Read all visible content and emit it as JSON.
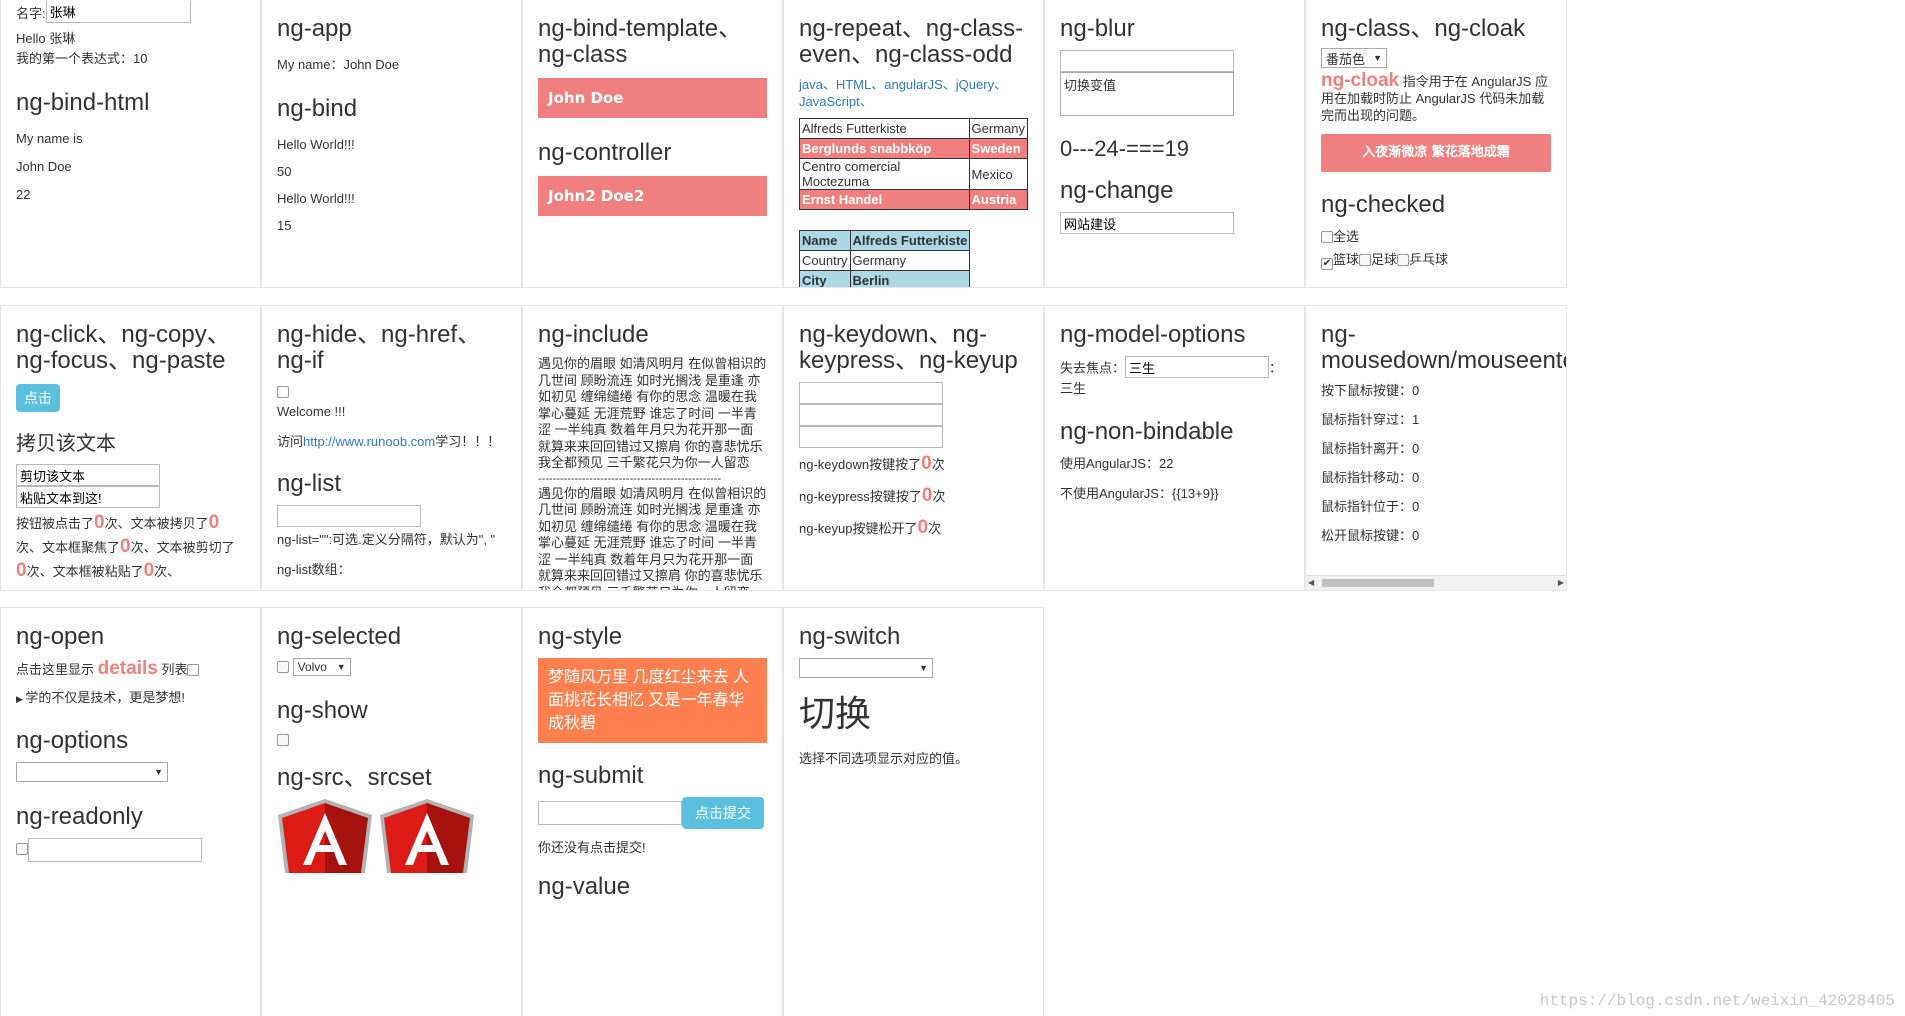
{
  "c1": {
    "name_label": "名字:",
    "name_value": "张琳",
    "hello": "Hello 张琳",
    "expr": "我的第一个表达式：10",
    "title": "ng-bind-html",
    "line1": "My name is",
    "line2": "John Doe",
    "line3": "22"
  },
  "c2": {
    "title": "ng-app",
    "line1": "My name：John Doe",
    "title2": "ng-bind",
    "l1": "Hello World!!!",
    "l2": "50",
    "l3": "Hello World!!!",
    "l4": "15"
  },
  "c3": {
    "title": "ng-bind-template、ng-class",
    "bar": "John Doe",
    "title2": "ng-controller",
    "bar2": "John2 Doe2"
  },
  "c4": {
    "title": "ng-repeat、ng-class-even、ng-class-odd",
    "links": "java、HTML、angularJS、jQuery、JavaScript、",
    "table": [
      [
        "Alfreds Futterkiste",
        "Germany"
      ],
      [
        "Berglunds snabbköp",
        "Sweden"
      ],
      [
        "Centro comercial Moctezuma",
        "Mexico"
      ],
      [
        "Ernst Handel",
        "Austria"
      ]
    ],
    "table2": [
      [
        "Name",
        "Alfreds Futterkiste"
      ],
      [
        "Country",
        "Germany"
      ],
      [
        "City",
        "Berlin"
      ]
    ]
  },
  "c5": {
    "title": "ng-blur",
    "textarea": "切换变值",
    "result": "0---24-===19",
    "title2": "ng-change",
    "input": "网站建设"
  },
  "c6": {
    "title": "ng-class、ng-cloak",
    "select": "番茄色",
    "cloak_word": "ng-cloak",
    "cloak_text": " 指令用于在 AngularJS 应用在加载时防止 AngularJS 代码未加载完而出现的问题。",
    "bar": "入夜渐微凉 繁花落地成霜",
    "title2": "ng-checked",
    "all": "全选",
    "opt1": "篮球",
    "opt2": "足球",
    "opt3": "乒乓球"
  },
  "r2c1": {
    "title": "ng-click、ng-copy、ng-focus、ng-paste",
    "button": "点击",
    "copy_title": "拷贝该文本",
    "in1": "剪切该文本",
    "in2": "粘贴文本到这!",
    "t1": "按钮被点击了",
    "n1": "0",
    "t2": "次、文本被拷贝了",
    "n2": "0",
    "t3": "次、文本框聚焦了",
    "n3": "0",
    "t4": "次、文本被剪切了",
    "n4": "0",
    "t5": "次、文本框被粘贴了",
    "n5": "0",
    "t6": "次、"
  },
  "r2c2": {
    "title": "ng-hide、ng-href、ng-if",
    "welcome": "Welcome !!!",
    "visit": "访问",
    "url": "http://www.runoob.com",
    "learn": "学习！！！",
    "title2": "ng-list",
    "hint": "ng-list=\"\":可选.定义分隔符，默认为\", \"",
    "arr": "ng-list数组："
  },
  "r2c3": {
    "title": "ng-include",
    "poem": "遇见你的眉眼 如清风明月 在似曾相识的几世间 顾盼流连 如时光搁浅 是重逢 亦如初见 缠绵缱绻 有你的思念 温暖在我掌心蔓延 无涯荒野 谁忘了时间 一半青涩 一半纯真 数着年月只为花开那一面 就算来来回回错过又擦肩 你的喜悲忧乐我全都预见 三千繁花只为你一人留恋",
    "dash": "--------------------------------------------------",
    "poem2": "遇见你的眉眼 如清风明月 在似曾相识的几世间 顾盼流连 如时光搁浅 是重逢 亦如初见 缠绵缱绻 有你的思念 温暖在我掌心蔓延 无涯荒野 谁忘了时间 一半青涩 一半纯真 数着年月只为花开那一面 就算来来回回错过又擦肩 你的喜悲忧乐我全都预见 三千繁花只为你一人留恋",
    "dash2": "--------------------------------------------------"
  },
  "r2c4": {
    "title": "ng-keydown、ng-keypress、ng-keyup",
    "k1": "ng-keydown按键按了",
    "k2": "ng-keypress按键按了",
    "k3": "ng-keyup按键松开了",
    "n": "0",
    "unit": "次"
  },
  "r2c5": {
    "title": "ng-model-options",
    "label": "失去焦点：",
    "value": "三生",
    "after": "：三生",
    "title2": "ng-non-bindable",
    "l1": "使用AngularJS：22",
    "l2": "不使用AngularJS：{{13+9}}"
  },
  "r2c6": {
    "title": "ng-mousedown/mouseenter/mouseleave",
    "l1": "按下鼠标按键：0",
    "l2": "鼠标指针穿过：1",
    "l3": "鼠标指针离开：0",
    "l4": "鼠标指针移动：0",
    "l5": "鼠标指针位于：0",
    "l6": "松开鼠标按键：0"
  },
  "r3c1": {
    "title": "ng-open",
    "line_a": "点击这里显示 ",
    "details": "details",
    "line_b": " 列表",
    "summary": "学的不仅是技术，更是梦想!",
    "title2": "ng-options",
    "title3": "ng-readonly"
  },
  "r3c2": {
    "title": "ng-selected",
    "select": "Volvo",
    "title2": "ng-show",
    "title3": "ng-src、srcset"
  },
  "r3c3": {
    "title": "ng-style",
    "bar": "梦随风万里 几度红尘来去 人面桃花长相忆 又是一年春华成秋碧",
    "title2": "ng-submit",
    "button": "点击提交",
    "status": "你还没有点击提交!",
    "title3": "ng-value"
  },
  "r3c4": {
    "title": "ng-switch",
    "big": "切换",
    "desc": "选择不同选项显示对应的值。"
  },
  "watermark": "https://blog.csdn.net/weixin_42028405",
  "colors": {
    "pink": "#f08080",
    "blue": "#5bc0de",
    "coral": "#ff7f50",
    "lightblue": "#add8e6"
  }
}
